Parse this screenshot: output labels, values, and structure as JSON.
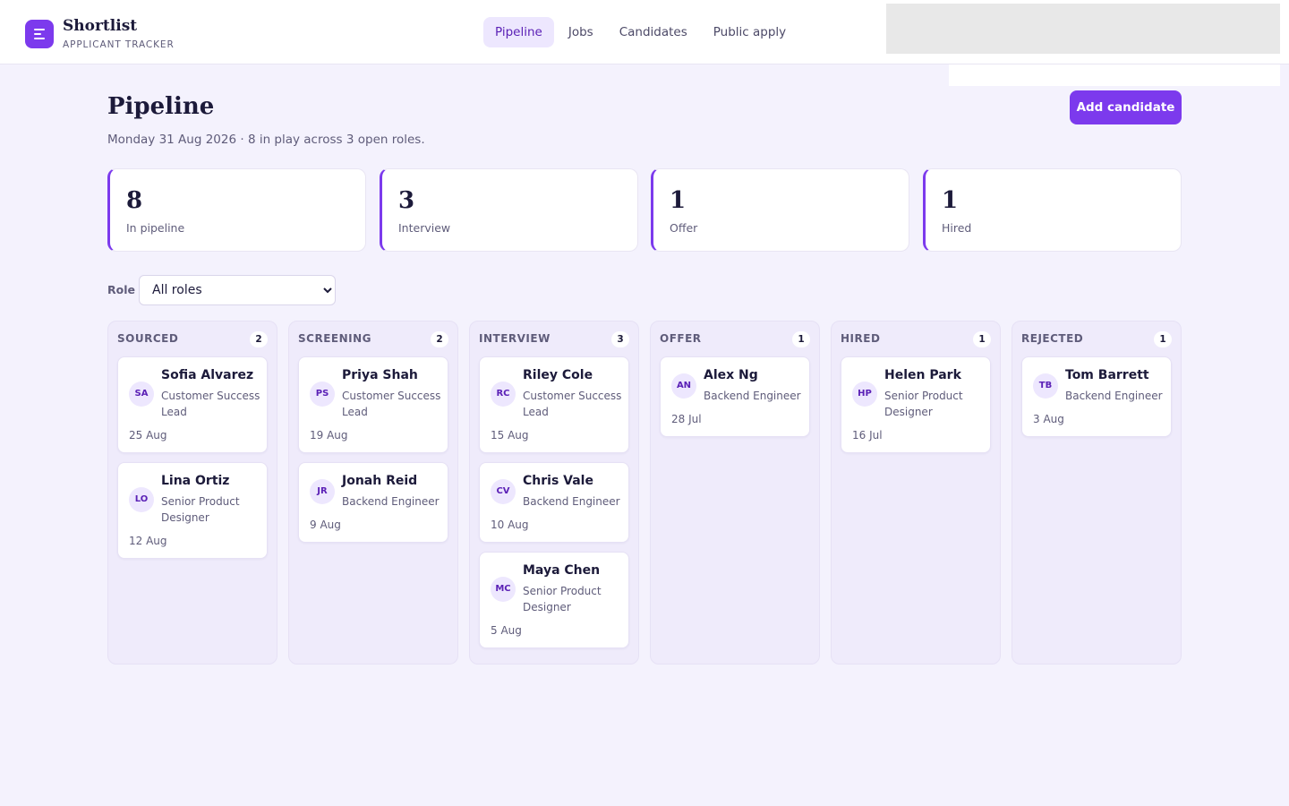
{
  "brand": {
    "name": "Shortlist",
    "subtitle": "APPLICANT TRACKER"
  },
  "nav": {
    "items": [
      {
        "label": "Pipeline",
        "active": true
      },
      {
        "label": "Jobs",
        "active": false
      },
      {
        "label": "Candidates",
        "active": false
      },
      {
        "label": "Public apply",
        "active": false
      }
    ]
  },
  "page": {
    "title": "Pipeline",
    "subtitle": "Monday 31 Aug 2026 · 8 in play across 3 open roles.",
    "add_button": "Add candidate"
  },
  "stats": [
    {
      "value": "8",
      "label": "In pipeline"
    },
    {
      "value": "3",
      "label": "Interview"
    },
    {
      "value": "1",
      "label": "Offer"
    },
    {
      "value": "1",
      "label": "Hired"
    }
  ],
  "filter": {
    "label": "Role",
    "selected": "All roles"
  },
  "columns": [
    {
      "title": "SOURCED",
      "count": "2",
      "cards": [
        {
          "initials": "SA",
          "name": "Sofia Alvarez",
          "role": "Customer Success Lead",
          "date": "25 Aug"
        },
        {
          "initials": "LO",
          "name": "Lina Ortiz",
          "role": "Senior Product Designer",
          "date": "12 Aug"
        }
      ]
    },
    {
      "title": "SCREENING",
      "count": "2",
      "cards": [
        {
          "initials": "PS",
          "name": "Priya Shah",
          "role": "Customer Success Lead",
          "date": "19 Aug"
        },
        {
          "initials": "JR",
          "name": "Jonah Reid",
          "role": "Backend Engineer",
          "date": "9 Aug"
        }
      ]
    },
    {
      "title": "INTERVIEW",
      "count": "3",
      "cards": [
        {
          "initials": "RC",
          "name": "Riley Cole",
          "role": "Customer Success Lead",
          "date": "15 Aug"
        },
        {
          "initials": "CV",
          "name": "Chris Vale",
          "role": "Backend Engineer",
          "date": "10 Aug"
        },
        {
          "initials": "MC",
          "name": "Maya Chen",
          "role": "Senior Product Designer",
          "date": "5 Aug"
        }
      ]
    },
    {
      "title": "OFFER",
      "count": "1",
      "cards": [
        {
          "initials": "AN",
          "name": "Alex Ng",
          "role": "Backend Engineer",
          "date": "28 Jul"
        }
      ]
    },
    {
      "title": "HIRED",
      "count": "1",
      "cards": [
        {
          "initials": "HP",
          "name": "Helen Park",
          "role": "Senior Product Designer",
          "date": "16 Jul"
        }
      ]
    },
    {
      "title": "REJECTED",
      "count": "1",
      "cards": [
        {
          "initials": "TB",
          "name": "Tom Barrett",
          "role": "Backend Engineer",
          "date": "3 Aug"
        }
      ]
    }
  ],
  "colors": {
    "accent": "#7c3aed",
    "accent_soft": "#ede7fe",
    "background": "#f4f2fd",
    "text": "#1c1a3a"
  }
}
